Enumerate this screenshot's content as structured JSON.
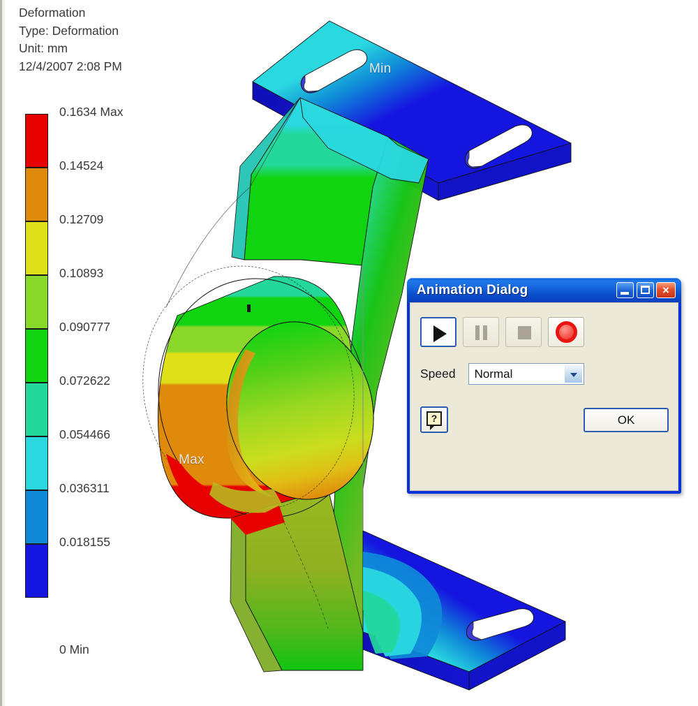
{
  "result_info": {
    "title": "Deformation",
    "type_line": "Type: Deformation",
    "unit_line": "Unit: mm",
    "timestamp": "12/4/2007 2:08 PM"
  },
  "legend": {
    "bands": [
      {
        "label": "0.1634 Max",
        "color": "#e60000"
      },
      {
        "label": "0.14524",
        "color": "#e08a0c"
      },
      {
        "label": "0.12709",
        "color": "#e0e019"
      },
      {
        "label": "0.10893",
        "color": "#8ad82a"
      },
      {
        "label": "0.090777",
        "color": "#11d411"
      },
      {
        "label": "0.072622",
        "color": "#23d89a"
      },
      {
        "label": "0.054466",
        "color": "#2ad8e0"
      },
      {
        "label": "0.036311",
        "color": "#0f8ad8"
      },
      {
        "label": "0.018155",
        "color": "#1515e0"
      },
      {
        "label": "0 Min",
        "color": "#1515e0"
      }
    ]
  },
  "model": {
    "min_tag": "Min",
    "max_tag": "Max"
  },
  "dialog": {
    "title": "Animation Dialog",
    "titlebar_buttons": {
      "minimize": "minimize-button",
      "maximize": "maximize-button",
      "close": "×"
    },
    "playback": {
      "play_label": "play-button",
      "pause_label": "pause-button",
      "stop_label": "stop-button",
      "record_label": "record-button"
    },
    "speed": {
      "label": "Speed",
      "value": "Normal",
      "options": [
        "Normal"
      ]
    },
    "help_glyph": "?",
    "ok_label": "OK"
  },
  "chart_data": {
    "type": "heatmap",
    "title": "Deformation",
    "subtitle": "Type: Deformation",
    "unit": "mm",
    "timestamp": "12/4/2007 2:08 PM",
    "legend_position": "left",
    "colorbar": {
      "min": 0,
      "max": 0.1634,
      "min_label": "0 Min",
      "max_label": "0.1634 Max",
      "tick_values": [
        0.1634,
        0.14524,
        0.12709,
        0.10893,
        0.090777,
        0.072622,
        0.054466,
        0.036311,
        0.018155,
        0
      ],
      "tick_labels": [
        "0.1634 Max",
        "0.14524",
        "0.12709",
        "0.10893",
        "0.090777",
        "0.072622",
        "0.054466",
        "0.036311",
        "0.018155",
        "0 Min"
      ],
      "band_colors": [
        "#e60000",
        "#e08a0c",
        "#e0e019",
        "#8ad82a",
        "#11d411",
        "#23d89a",
        "#2ad8e0",
        "#0f8ad8",
        "#1515e0"
      ],
      "band_count": 9
    },
    "annotations": [
      {
        "text": "Min",
        "value": 0,
        "location": "top mounting plate"
      },
      {
        "text": "Max",
        "value": 0.1634,
        "location": "central ring boss, lower-left edge"
      }
    ]
  }
}
